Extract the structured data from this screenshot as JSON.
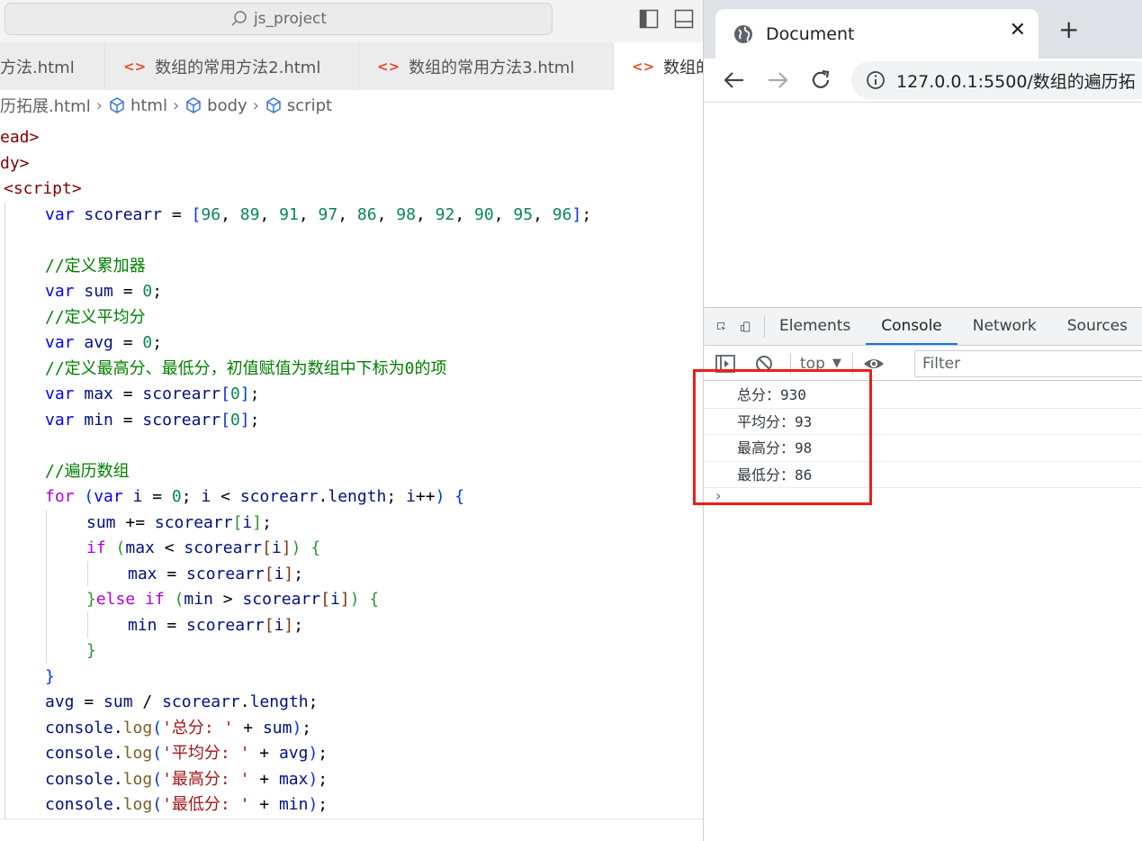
{
  "editor": {
    "search": "js_project",
    "tabs": [
      {
        "label": "方法.html",
        "icon": "<>"
      },
      {
        "label": "数组的常用方法2.html",
        "icon": "<>"
      },
      {
        "label": "数组的常用方法3.html",
        "icon": "<>"
      },
      {
        "label": "数组的",
        "icon": "<>"
      }
    ],
    "breadcrumb": [
      "历拓展.html",
      "html",
      "body",
      "script"
    ],
    "code": {
      "l1_tag": "ead>",
      "l2_tag": "dy>",
      "l3_tag": "<script>",
      "l4_var": "var",
      "l4_name": "scorearr",
      "l4_eq": " = ",
      "l4_open": "[",
      "l4_close": "]",
      "scores": [
        "96",
        "89",
        "91",
        "97",
        "86",
        "98",
        "92",
        "90",
        "95",
        "96"
      ],
      "c1": "//定义累加器",
      "sum_name": "sum",
      "zero": "0",
      "c2": "//定义平均分",
      "avg_name": "avg",
      "c3": "//定义最高分、最低分，初值赋值为数组中下标为0的项",
      "max_name": "max",
      "min_name": "min",
      "c4": "//遍历数组",
      "for_kw": "for",
      "if_kw": "if",
      "else_kw": "else",
      "i_name": "i",
      "length": "length",
      "console": "console",
      "log": "log",
      "s_total": "'总分: '",
      "s_avg": "'平均分: '",
      "s_max": "'最高分: '",
      "s_min": "'最低分: '"
    }
  },
  "browser": {
    "tab_title": "Document",
    "tab_close": "✕",
    "new_tab": "+",
    "url": "127.0.0.1:5500/数组的遍历拓",
    "devtools": {
      "tabs": [
        "Elements",
        "Console",
        "Network",
        "Sources"
      ],
      "active_tab": "Console",
      "context": "top",
      "filter_placeholder": "Filter",
      "logs": [
        "总分：930",
        "平均分：93",
        "最高分：98",
        "最低分：86"
      ],
      "prompt": "›"
    }
  },
  "colors": {
    "highlight": "#ee1c1c",
    "accent": "#1a73e8"
  }
}
